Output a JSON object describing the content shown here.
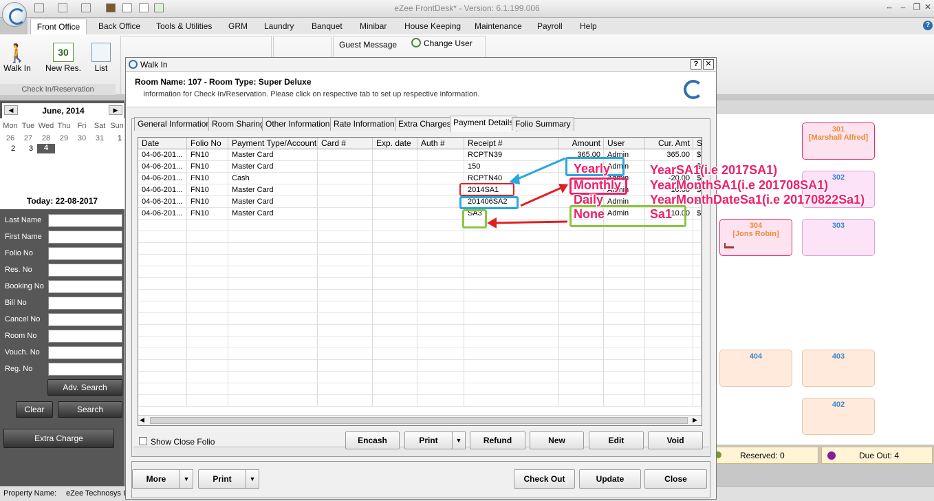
{
  "app": {
    "title": "eZee FrontDesk* - Version: 6.1.199.006"
  },
  "menu": [
    "Front Office",
    "Back Office",
    "Tools & Utilities",
    "GRM",
    "Laundry",
    "Banquet",
    "Minibar",
    "House Keeping",
    "Maintenance",
    "Payroll",
    "Help"
  ],
  "ribbon": {
    "walk_in": "Walk In",
    "new_res": "New Res.",
    "list": "List",
    "group": "Check In/Reservation",
    "guest_message": "Guest Message",
    "change_user": "Change User",
    "cal_icon_num": "30"
  },
  "calendar": {
    "month": "June, 2014",
    "days": [
      "Mon",
      "Tue",
      "Wed",
      "Thu",
      "Fri",
      "Sat",
      "Sun"
    ],
    "row1": [
      "26",
      "27",
      "28",
      "29",
      "30",
      "31",
      "1"
    ],
    "row2": [
      "2",
      "3",
      "4"
    ],
    "today": "Today: 22-08-2017"
  },
  "search": {
    "fields": [
      "Last Name",
      "First Name",
      "Folio No",
      "Res. No",
      "Booking No",
      "Bill No",
      "Cancel No",
      "Room No",
      "Vouch. No",
      "Reg. No"
    ],
    "adv": "Adv. Search",
    "clear": "Clear",
    "search": "Search",
    "extra": "Extra Charge"
  },
  "dialog": {
    "title": "Walk In",
    "heading": "Room Name: 107 - Room Type: Super Deluxe",
    "info": "Information for Check In/Reservation. Please click on respective tab to set up respective information.",
    "help": "?",
    "close": "✕"
  },
  "tabs": [
    "General Information",
    "Room Sharing",
    "Other Information",
    "Rate Information",
    "Extra Charges",
    "Payment Details",
    "Folio Summary"
  ],
  "grid": {
    "headers": [
      "Date",
      "Folio No",
      "Payment Type/Account",
      "Card #",
      "Exp. date",
      "Auth #",
      "Receipt #",
      "Amount",
      "User",
      "Cur. Amt",
      "S"
    ],
    "rows": [
      [
        "04-06-201...",
        "FN10",
        "Master Card",
        "",
        "",
        "",
        "RCPTN39",
        "365.00",
        "Admin",
        "365.00",
        "$"
      ],
      [
        "04-06-201...",
        "FN10",
        "Master Card",
        "",
        "",
        "",
        "150",
        "",
        "Admin",
        "",
        "$"
      ],
      [
        "04-06-201...",
        "FN10",
        "Cash",
        "",
        "",
        "",
        "RCPTN40",
        "",
        "Admin",
        "-20.00",
        "$"
      ],
      [
        "04-06-201...",
        "FN10",
        "Master Card",
        "",
        "",
        "",
        "2014SA1",
        "",
        "Admin",
        "10.00",
        "$"
      ],
      [
        "04-06-201...",
        "FN10",
        "Master Card",
        "",
        "",
        "",
        "201406SA2",
        "",
        "Admin",
        "",
        "$"
      ],
      [
        "04-06-201...",
        "FN10",
        "Master Card",
        "",
        "",
        "",
        "SA3",
        "",
        "Admin",
        "10.00",
        "$"
      ]
    ]
  },
  "buttons": {
    "show_close": "Show Close Folio",
    "encash": "Encash",
    "print": "Print",
    "refund": "Refund",
    "new": "New",
    "edit": "Edit",
    "void": "Void",
    "more": "More",
    "print2": "Print",
    "checkout": "Check Out",
    "update": "Update",
    "close": "Close"
  },
  "annotations": {
    "yearly": "Yearly",
    "monthly": "Monthly",
    "daily": "Daily",
    "none": "None",
    "year_fmt": "YearSA1(i.e 2017SA1)",
    "month_fmt": "YearMonthSA1(i.e 201708SA1)",
    "date_fmt": "YearMonthDateSa1(i.e 20170822Sa1)",
    "sa1": "Sa1"
  },
  "rooms": [
    {
      "num": "301",
      "guest": "[Marshall Alfred]"
    },
    {
      "num": "302",
      "guest": ""
    },
    {
      "num": "304",
      "guest": "[Jons Robin]"
    },
    {
      "num": "303",
      "guest": ""
    },
    {
      "num": "404",
      "guest": ""
    },
    {
      "num": "403",
      "guest": ""
    },
    {
      "num": "402",
      "guest": ""
    }
  ],
  "legend": {
    "reserved": "Reserved: 0",
    "dueout": "Due Out: 4"
  },
  "status": {
    "property": "Property Name:",
    "value": "eZee Technosys I"
  }
}
